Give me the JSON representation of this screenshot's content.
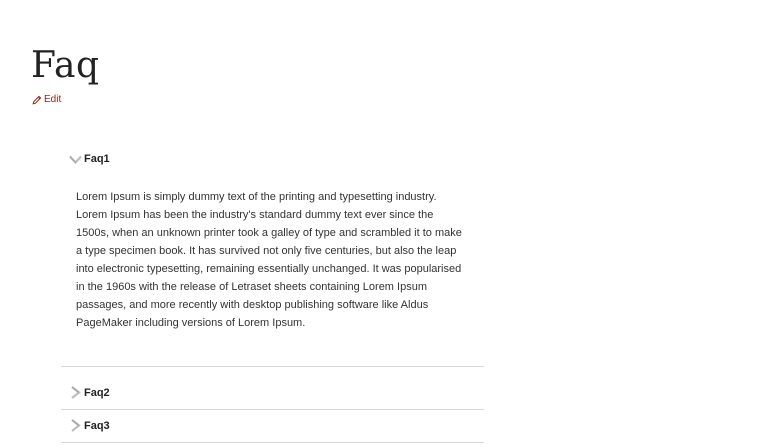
{
  "page": {
    "title": "Faq",
    "edit_label": "Edit"
  },
  "accordion": {
    "items": [
      {
        "title": "Faq1",
        "expanded": true,
        "body": "Lorem Ipsum is simply dummy text of the printing and typesetting industry. Lorem Ipsum has been the industry's standard dummy text ever since the 1500s, when an unknown printer took a galley of type and scrambled it to make a type specimen book. It has survived not only five centuries, but also the leap into electronic typesetting, remaining essentially unchanged. It was popularised in the 1960s with the release of Letraset sheets containing Lorem Ipsum passages, and more recently with desktop publishing software like Aldus PageMaker including versions of Lorem Ipsum."
      },
      {
        "title": "Faq2",
        "expanded": false
      },
      {
        "title": "Faq3",
        "expanded": false
      }
    ]
  },
  "icons": {
    "edit": "pencil-icon",
    "expanded": "chevron-down-icon",
    "collapsed": "chevron-right-icon"
  },
  "colors": {
    "link": "#8a2a14",
    "divider": "#d6d6d6",
    "icon": "#bdbdbd"
  }
}
